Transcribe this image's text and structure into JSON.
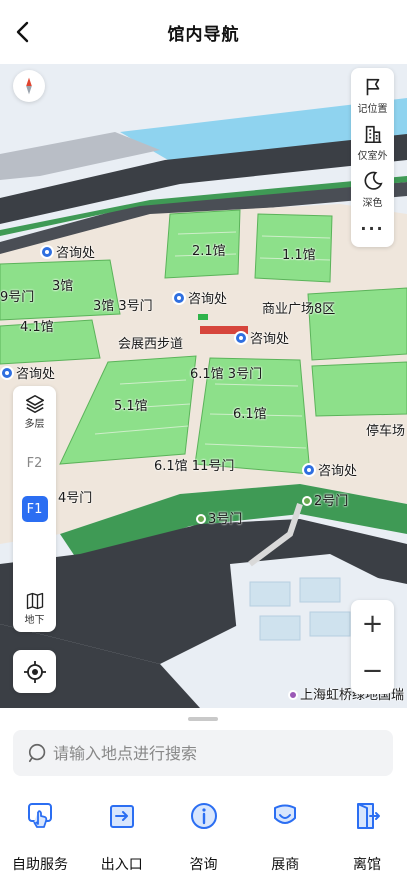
{
  "header": {
    "title": "馆内导航",
    "back_icon": "chevron-left-icon"
  },
  "map": {
    "labels": {
      "hall_2_1": "2.1馆",
      "hall_1_1": "1.1馆",
      "hall_3": "3馆",
      "hall_4_1": "4.1馆",
      "hall_5_1": "5.1馆",
      "hall_6_1": "6.1馆",
      "gate_9": "9号门",
      "hall3_gate3": "3馆 3号门",
      "plaza": "商业广场8区",
      "west_walk": "会展西步道",
      "hall61_gate3": "6.1馆 3号门",
      "hall61_gate11": "6.1馆 11号门",
      "info_1": "咨询处",
      "info_2": "咨询处",
      "info_3": "咨询处",
      "info_4": "咨询处",
      "info_5": "咨询处",
      "gate_4": "4号门",
      "gate_2": "2号门",
      "gate_3": "3号门",
      "parking": "停车场",
      "station": "上海虹桥绿地国瑞"
    }
  },
  "right_panel": {
    "items": [
      {
        "label": "记位置",
        "icon": "flag-icon"
      },
      {
        "label": "仅室外",
        "icon": "building-icon"
      },
      {
        "label": "深色",
        "icon": "moon-icon"
      }
    ],
    "more_label": "···"
  },
  "floor_panel": {
    "top_label": "多层",
    "floors": [
      "F2",
      "F1"
    ],
    "active_floor": "F1",
    "bottom_label": "地下"
  },
  "zoom": {
    "in_label": "+",
    "out_label": "−"
  },
  "search": {
    "placeholder": "请输入地点进行搜索"
  },
  "tabs": [
    {
      "label": "自助服务",
      "icon": "self-service-icon"
    },
    {
      "label": "出入口",
      "icon": "entrance-icon"
    },
    {
      "label": "咨询",
      "icon": "info-icon"
    },
    {
      "label": "展商",
      "icon": "exhibitor-icon"
    },
    {
      "label": "离馆",
      "icon": "exit-door-icon"
    }
  ],
  "colors": {
    "accent": "#2b6ef2",
    "hall_green": "#8de08a",
    "road": "#3b3f45"
  }
}
